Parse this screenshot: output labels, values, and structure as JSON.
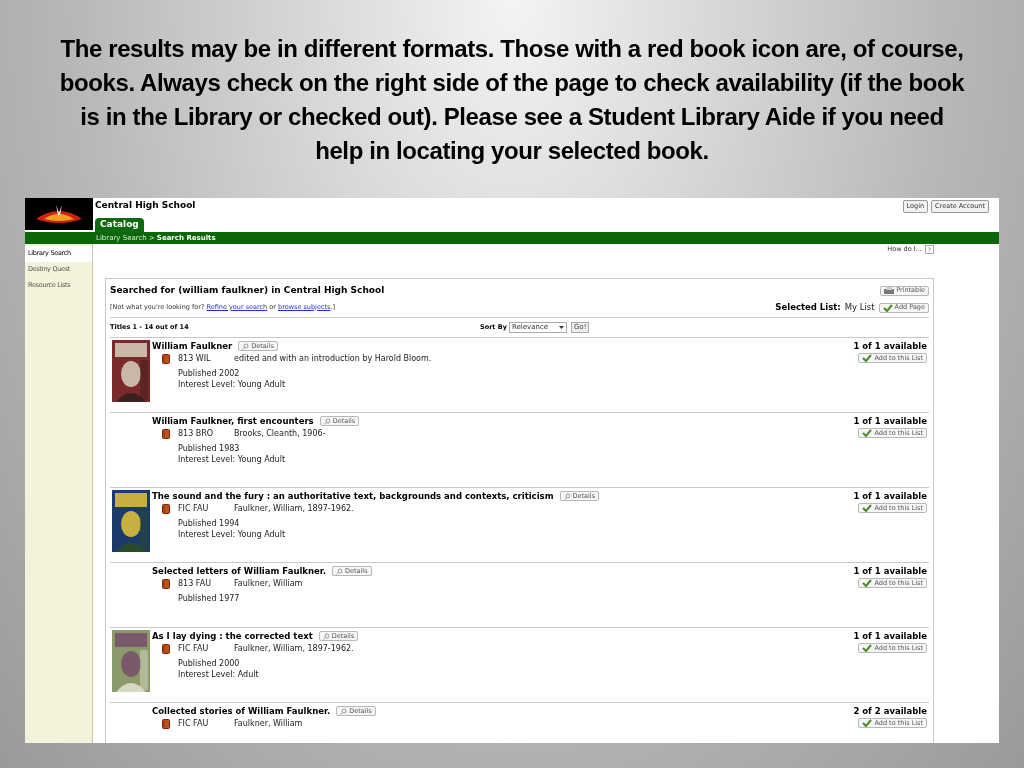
{
  "caption": "The results may be in different formats. Those with a red book icon are, of course, books. Always check on the right side of the page to check availability (if the book is in the Library or checked out). Please see a Student Library Aide if you need help in locating your selected book.",
  "header": {
    "school": "Central High School",
    "buttons": [
      "Login",
      "Create Account"
    ]
  },
  "tabs": [
    {
      "label": "Catalog",
      "selected": true
    }
  ],
  "breadcrumb": {
    "path": "Library Search >",
    "current": "Search Results"
  },
  "sidebar": {
    "items": [
      {
        "label": "Library Search",
        "selected": true
      },
      {
        "label": "Destiny Quest",
        "selected": false
      },
      {
        "label": "Resource Lists",
        "selected": false
      }
    ]
  },
  "help": {
    "label": "How do I...",
    "button": "?"
  },
  "panel": {
    "heading": "Searched for (william faulkner) in Central High School",
    "hint": {
      "before": "[Not what you're looking for?",
      "link1": "Refine your search",
      "middle": "or",
      "link2": "browse subjects",
      "after": ".]"
    },
    "printable": "Printable",
    "selected_list": {
      "label": "Selected List:",
      "value": "My List",
      "button": "Add Page"
    },
    "count": "Titles 1 - 14 out of 14",
    "sort": {
      "label": "Sort By",
      "value": "Relevance",
      "go": "Go!"
    },
    "results": [
      {
        "title": "William Faulkner",
        "details": "Details",
        "call_number": "813 WIL",
        "author": "edited and with an introduction by Harold Bloom.",
        "published": "Published 2002",
        "interest": "Interest Level: Young Adult",
        "availability": "1 of 1 available",
        "add": "Add to this List"
      },
      {
        "title": "William Faulkner, first encounters",
        "details": "Details",
        "call_number": "813 BRO",
        "author": "Brooks, Cleanth, 1906-",
        "published": "Published 1983",
        "interest": "Interest Level: Young Adult",
        "availability": "1 of 1 available",
        "add": "Add to this List"
      },
      {
        "title": "The sound and the fury : an authoritative text, backgrounds and contexts, criticism",
        "details": "Details",
        "call_number": "FIC FAU",
        "author": "Faulkner, William, 1897-1962.",
        "published": "Published 1994",
        "interest": "Interest Level: Young Adult",
        "availability": "1 of 1 available",
        "add": "Add to this List"
      },
      {
        "title": "Selected letters of William Faulkner.",
        "details": "Details",
        "call_number": "813 FAU",
        "author": "Faulkner, William",
        "published": "Published 1977",
        "availability": "1 of 1 available",
        "add": "Add to this List"
      },
      {
        "title": "As I lay dying : the corrected text",
        "details": "Details",
        "call_number": "FIC FAU",
        "author": "Faulkner, William, 1897-1962.",
        "published": "Published 2000",
        "interest": "Interest Level: Adult",
        "availability": "1 of 1 available",
        "add": "Add to this List"
      },
      {
        "title": "Collected stories of William Faulkner.",
        "details": "Details",
        "call_number": "FIC FAU",
        "author": "Faulkner, William",
        "availability": "2 of 2 available",
        "add": "Add to this List"
      }
    ]
  }
}
